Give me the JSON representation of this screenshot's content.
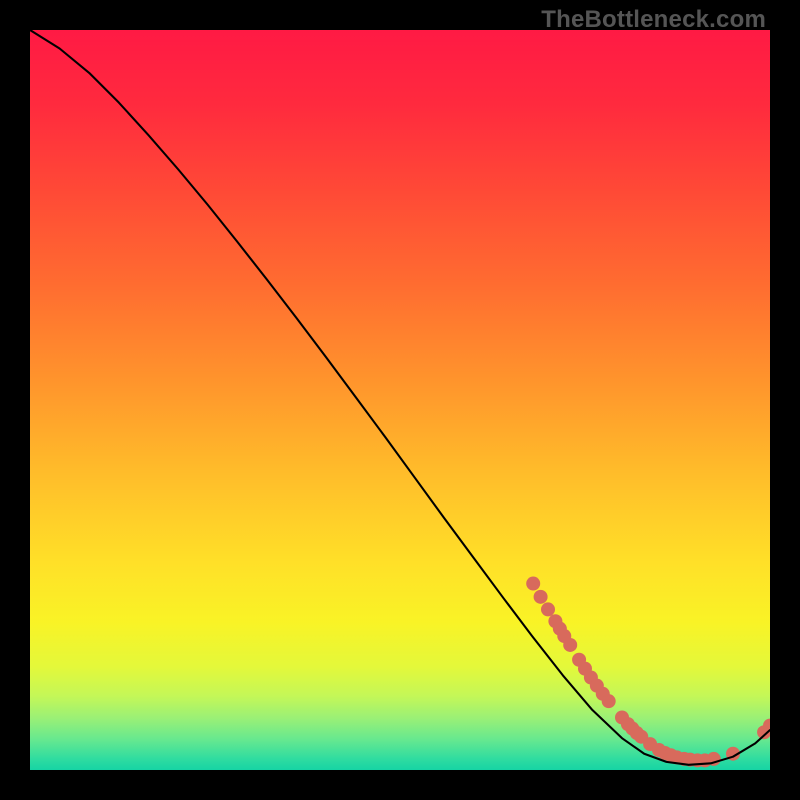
{
  "watermark": "TheBottleneck.com",
  "gradient": {
    "stops": [
      {
        "offset": 0.0,
        "color": "#ff1a44"
      },
      {
        "offset": 0.1,
        "color": "#ff2a3e"
      },
      {
        "offset": 0.22,
        "color": "#ff4a36"
      },
      {
        "offset": 0.35,
        "color": "#ff6e30"
      },
      {
        "offset": 0.48,
        "color": "#ff962c"
      },
      {
        "offset": 0.6,
        "color": "#ffbd2a"
      },
      {
        "offset": 0.72,
        "color": "#ffe028"
      },
      {
        "offset": 0.8,
        "color": "#f9f326"
      },
      {
        "offset": 0.86,
        "color": "#e4f83a"
      },
      {
        "offset": 0.9,
        "color": "#c4f757"
      },
      {
        "offset": 0.93,
        "color": "#9af076"
      },
      {
        "offset": 0.96,
        "color": "#64e890"
      },
      {
        "offset": 0.985,
        "color": "#2fdca0"
      },
      {
        "offset": 1.0,
        "color": "#16d4a4"
      }
    ]
  },
  "chart_data": {
    "type": "line",
    "title": "",
    "xlabel": "",
    "ylabel": "",
    "xlim": [
      0,
      100
    ],
    "ylim": [
      0,
      100
    ],
    "legend": false,
    "grid": false,
    "series": [
      {
        "name": "curve",
        "color": "#000000",
        "x": [
          0,
          4,
          8,
          12,
          16,
          20,
          24,
          28,
          32,
          36,
          40,
          44,
          48,
          52,
          56,
          60,
          64,
          68,
          72,
          76,
          80,
          83,
          86,
          89,
          92,
          95,
          98,
          100
        ],
        "y": [
          100,
          97.5,
          94.2,
          90.2,
          85.8,
          81.2,
          76.4,
          71.4,
          66.3,
          61.1,
          55.8,
          50.4,
          45.0,
          39.5,
          34.0,
          28.6,
          23.2,
          17.9,
          12.8,
          8.1,
          4.3,
          2.2,
          1.1,
          0.7,
          0.9,
          1.8,
          3.6,
          5.4
        ]
      }
    ],
    "scatter": {
      "name": "markers",
      "color": "#d86a5c",
      "radius_px": 7,
      "points": [
        {
          "x": 68,
          "y": 25.2
        },
        {
          "x": 69,
          "y": 23.4
        },
        {
          "x": 70,
          "y": 21.7
        },
        {
          "x": 71,
          "y": 20.1
        },
        {
          "x": 71.6,
          "y": 19.1
        },
        {
          "x": 72.2,
          "y": 18.1
        },
        {
          "x": 73.0,
          "y": 16.9
        },
        {
          "x": 74.2,
          "y": 14.9
        },
        {
          "x": 75.0,
          "y": 13.7
        },
        {
          "x": 75.8,
          "y": 12.5
        },
        {
          "x": 76.6,
          "y": 11.4
        },
        {
          "x": 77.4,
          "y": 10.3
        },
        {
          "x": 78.2,
          "y": 9.3
        },
        {
          "x": 80.0,
          "y": 7.1
        },
        {
          "x": 80.8,
          "y": 6.2
        },
        {
          "x": 81.4,
          "y": 5.6
        },
        {
          "x": 82.0,
          "y": 5.0
        },
        {
          "x": 82.6,
          "y": 4.5
        },
        {
          "x": 83.8,
          "y": 3.5
        },
        {
          "x": 85.0,
          "y": 2.7
        },
        {
          "x": 85.8,
          "y": 2.3
        },
        {
          "x": 86.6,
          "y": 2.0
        },
        {
          "x": 87.4,
          "y": 1.7
        },
        {
          "x": 88.4,
          "y": 1.5
        },
        {
          "x": 89.2,
          "y": 1.4
        },
        {
          "x": 90.2,
          "y": 1.3
        },
        {
          "x": 91.2,
          "y": 1.3
        },
        {
          "x": 92.4,
          "y": 1.5
        },
        {
          "x": 95.0,
          "y": 2.2
        },
        {
          "x": 99.2,
          "y": 5.1
        },
        {
          "x": 100.0,
          "y": 6.0
        }
      ]
    }
  }
}
